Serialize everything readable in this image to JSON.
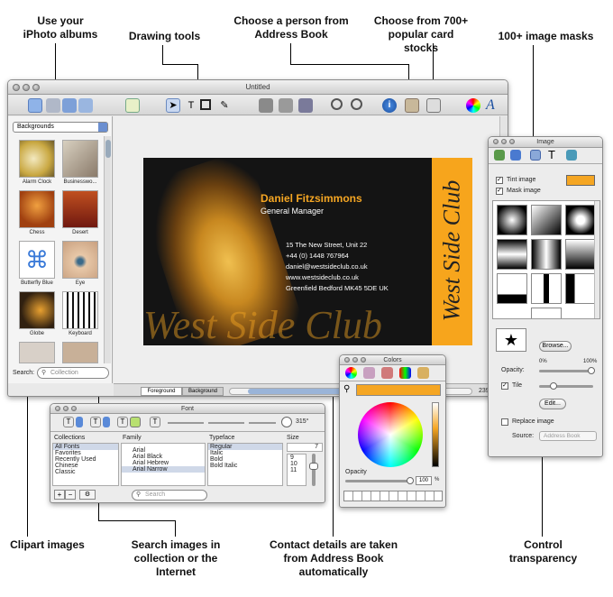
{
  "callouts": {
    "iphoto": "Use your iPhoto albums",
    "drawing": "Drawing tools",
    "person": "Choose a person from Address Book",
    "cardstocks": "Choose from 700+ popular card stocks",
    "masks": "100+ image masks",
    "clipart": "Clipart images",
    "search": "Search images in collection or the Internet",
    "contact": "Contact details are taken from Address Book automatically",
    "transparency": "Control transparency"
  },
  "main_window": {
    "title": "Untitled",
    "category": "Backgrounds",
    "search_label": "Search:",
    "search_placeholder": "Collection",
    "thumbs": [
      "Alarm Clock",
      "Businesswo...",
      "Chess",
      "Desert",
      "Butterfly Blue",
      "Eye",
      "Globe",
      "Keyboard"
    ],
    "tabs": [
      "Foreground",
      "Background"
    ],
    "zoom": "239%"
  },
  "card": {
    "name": "Daniel Fitzsimmons",
    "job": "General Manager",
    "address": "15 The New Street, Unit 22",
    "phone": "+44 (0) 1448 767964",
    "email": "daniel@westsideclub.co.uk",
    "web": "www.westsideclub.co.uk",
    "city": "Greenfield Bedford MK45 5DE UK",
    "brand_vertical": "West Side Club",
    "brand_bottom": "West Side Club"
  },
  "image_panel": {
    "title": "Image",
    "tint": "Tint image",
    "mask": "Mask image",
    "browse": "Browse...",
    "opacity": "Opacity:",
    "min": "0%",
    "max": "100%",
    "tile": "Tile",
    "edit": "Edit...",
    "replace": "Replace image",
    "source_label": "Source:",
    "source_value": "Address Book"
  },
  "font_panel": {
    "title": "Font",
    "angle": "315°",
    "headers": [
      "Collections",
      "Family",
      "Typeface",
      "Size"
    ],
    "collections": [
      "All Fonts",
      "Favorites",
      "Recently Used",
      "Chinese",
      "Classic"
    ],
    "families": [
      "Arial",
      "Arial Black",
      "Arial Hebrew",
      "Arial Narrow"
    ],
    "typefaces": [
      "Regular",
      "Italic",
      "Bold",
      "Bold Italic"
    ],
    "size_value": "7",
    "sizes": [
      "9",
      "10",
      "11"
    ],
    "search_placeholder": "Search"
  },
  "colors_panel": {
    "title": "Colors",
    "opacity_label": "Opacity",
    "opacity_value": "100",
    "percent": "%"
  },
  "colors": {
    "accent": "#f5a623",
    "card_bg": "#141414",
    "stripe": "#f7a51c"
  }
}
